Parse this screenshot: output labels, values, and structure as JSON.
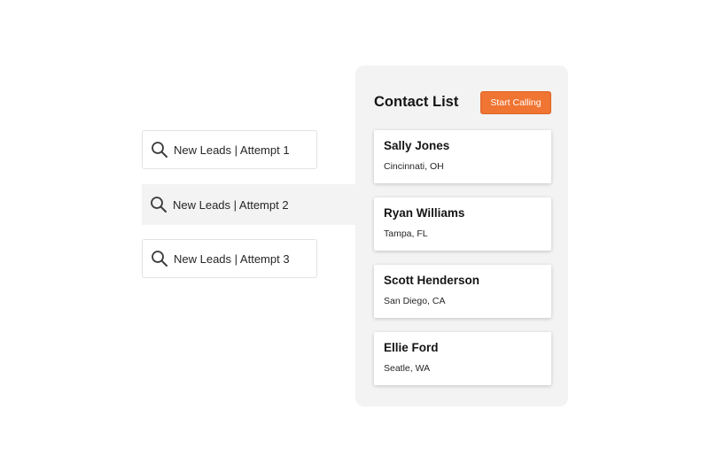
{
  "saved_searches": [
    {
      "label": "New Leads | Attempt 1",
      "icon": "search-icon",
      "active": false
    },
    {
      "label": "New Leads | Attempt 2",
      "icon": "search-icon",
      "active": true
    },
    {
      "label": "New Leads | Attempt 3",
      "icon": "search-icon",
      "active": false
    }
  ],
  "contact_list": {
    "title": "Contact List",
    "start_button_label": "Start Calling",
    "contacts": [
      {
        "name": "Sally Jones",
        "location": "Cincinnati, OH"
      },
      {
        "name": "Ryan Williams",
        "location": "Tampa, FL"
      },
      {
        "name": "Scott Henderson",
        "location": "San Diego, CA"
      },
      {
        "name": "Ellie Ford",
        "location": "Seatle, WA"
      }
    ]
  },
  "colors": {
    "accent": "#f07432",
    "panel_background": "#f3f3f3",
    "active_row_background": "#f3f3f3",
    "text": "#151515"
  }
}
